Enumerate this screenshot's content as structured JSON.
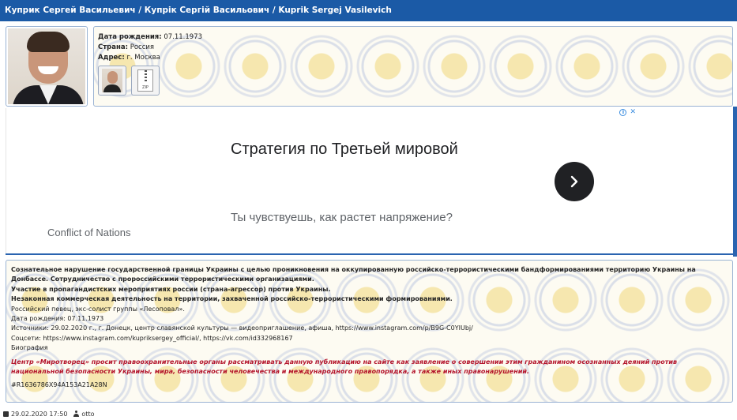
{
  "header": {
    "title": "Куприк Сергей Васильевич / Купрік Сергій Васильович / Kuprik Sergej Vasilevich"
  },
  "profile": {
    "photo_icon": "person-photo",
    "birth_label": "Дата рождения:",
    "birth_value": "07.11.1973",
    "country_label": "Страна:",
    "country_value": "Россия",
    "address_label": "Адрес:",
    "address_value": "г. Москва",
    "thumbs": {
      "photo_icon": "photo-thumbnail-icon",
      "zip_icon": "zip-file-icon",
      "zip_text": "ZIP"
    }
  },
  "ad": {
    "title": "Стратегия по Третьей мировой",
    "description": "Ты чувствуешь, как растет напряжение?",
    "advertiser": "Conflict of Nations",
    "badge_info": "i",
    "badge_close": "✕",
    "arrow_icon": "chevron-right-icon"
  },
  "description": {
    "bold_lines": [
      "Сознательное нарушение государственной границы Украины с целью проникновения на оккупированную российско-террористическими бандформированиями территорию Украины на",
      "Донбассе. Сотрудничество с пророссийскими террористическими организациями.",
      "Участие в пропагандистских мероприятиях россии (страна-агрессор) против Украины.",
      "Незаконная коммерческая деятельность на территории, захваченной российско-террористическими формированиями."
    ],
    "lines": [
      "Российский певец, экс-солист группы «Лесоповал».",
      "Дата рождения: 07.11.1973",
      "Источники: 29.02.2020 г., г. Донецк, центр славянской культуры — видеоприглашение, афиша, https://www.instagram.com/p/B9G-C0YIUbj/",
      "Соцсети: https://www.instagram.com/kupriksergey_official/, https://vk.com/id332968167",
      "Биография"
    ],
    "warning_lines": [
      "Центр «Миротворец» просит правоохранительные органы рассматривать данную публикацию на сайте как заявление о совершении этим гражданином осознанных деяний против",
      "национальной безопасности Украины, мира, безопасности человечества и международного правопорядка, а также иных правонарушений."
    ],
    "hash": "#R1636786X94A153A21A28N"
  },
  "footer": {
    "date": "29.02.2020 17:50",
    "author": "otto",
    "date_icon": "calendar-icon",
    "author_icon": "user-icon"
  },
  "colors": {
    "header_bg": "#1b5aa6",
    "warning": "#b3132a",
    "ad_arrow_bg": "#202124"
  }
}
